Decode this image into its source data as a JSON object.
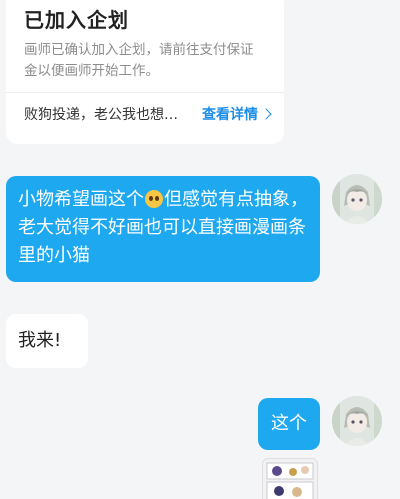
{
  "card": {
    "title": "已加入企划",
    "description": "画师已确认加入企划，请前往支付保证金以便画师开始工作。",
    "footer_text": "败狗投递，老公我也想…",
    "link_label": "查看详情"
  },
  "messages": [
    {
      "sender": "self",
      "text_before_emoji": "小物希望画这个",
      "emoji": "pleading-face-emoji",
      "text_after_emoji": "但感觉有点抽象，老大觉得不好画也可以直接画漫画条里的小猫"
    },
    {
      "sender": "other",
      "text": "我来!"
    },
    {
      "sender": "self",
      "text": "这个"
    }
  ],
  "colors": {
    "accent": "#1ea8ef",
    "link": "#1e8ee8",
    "background": "#f4f5f7"
  }
}
